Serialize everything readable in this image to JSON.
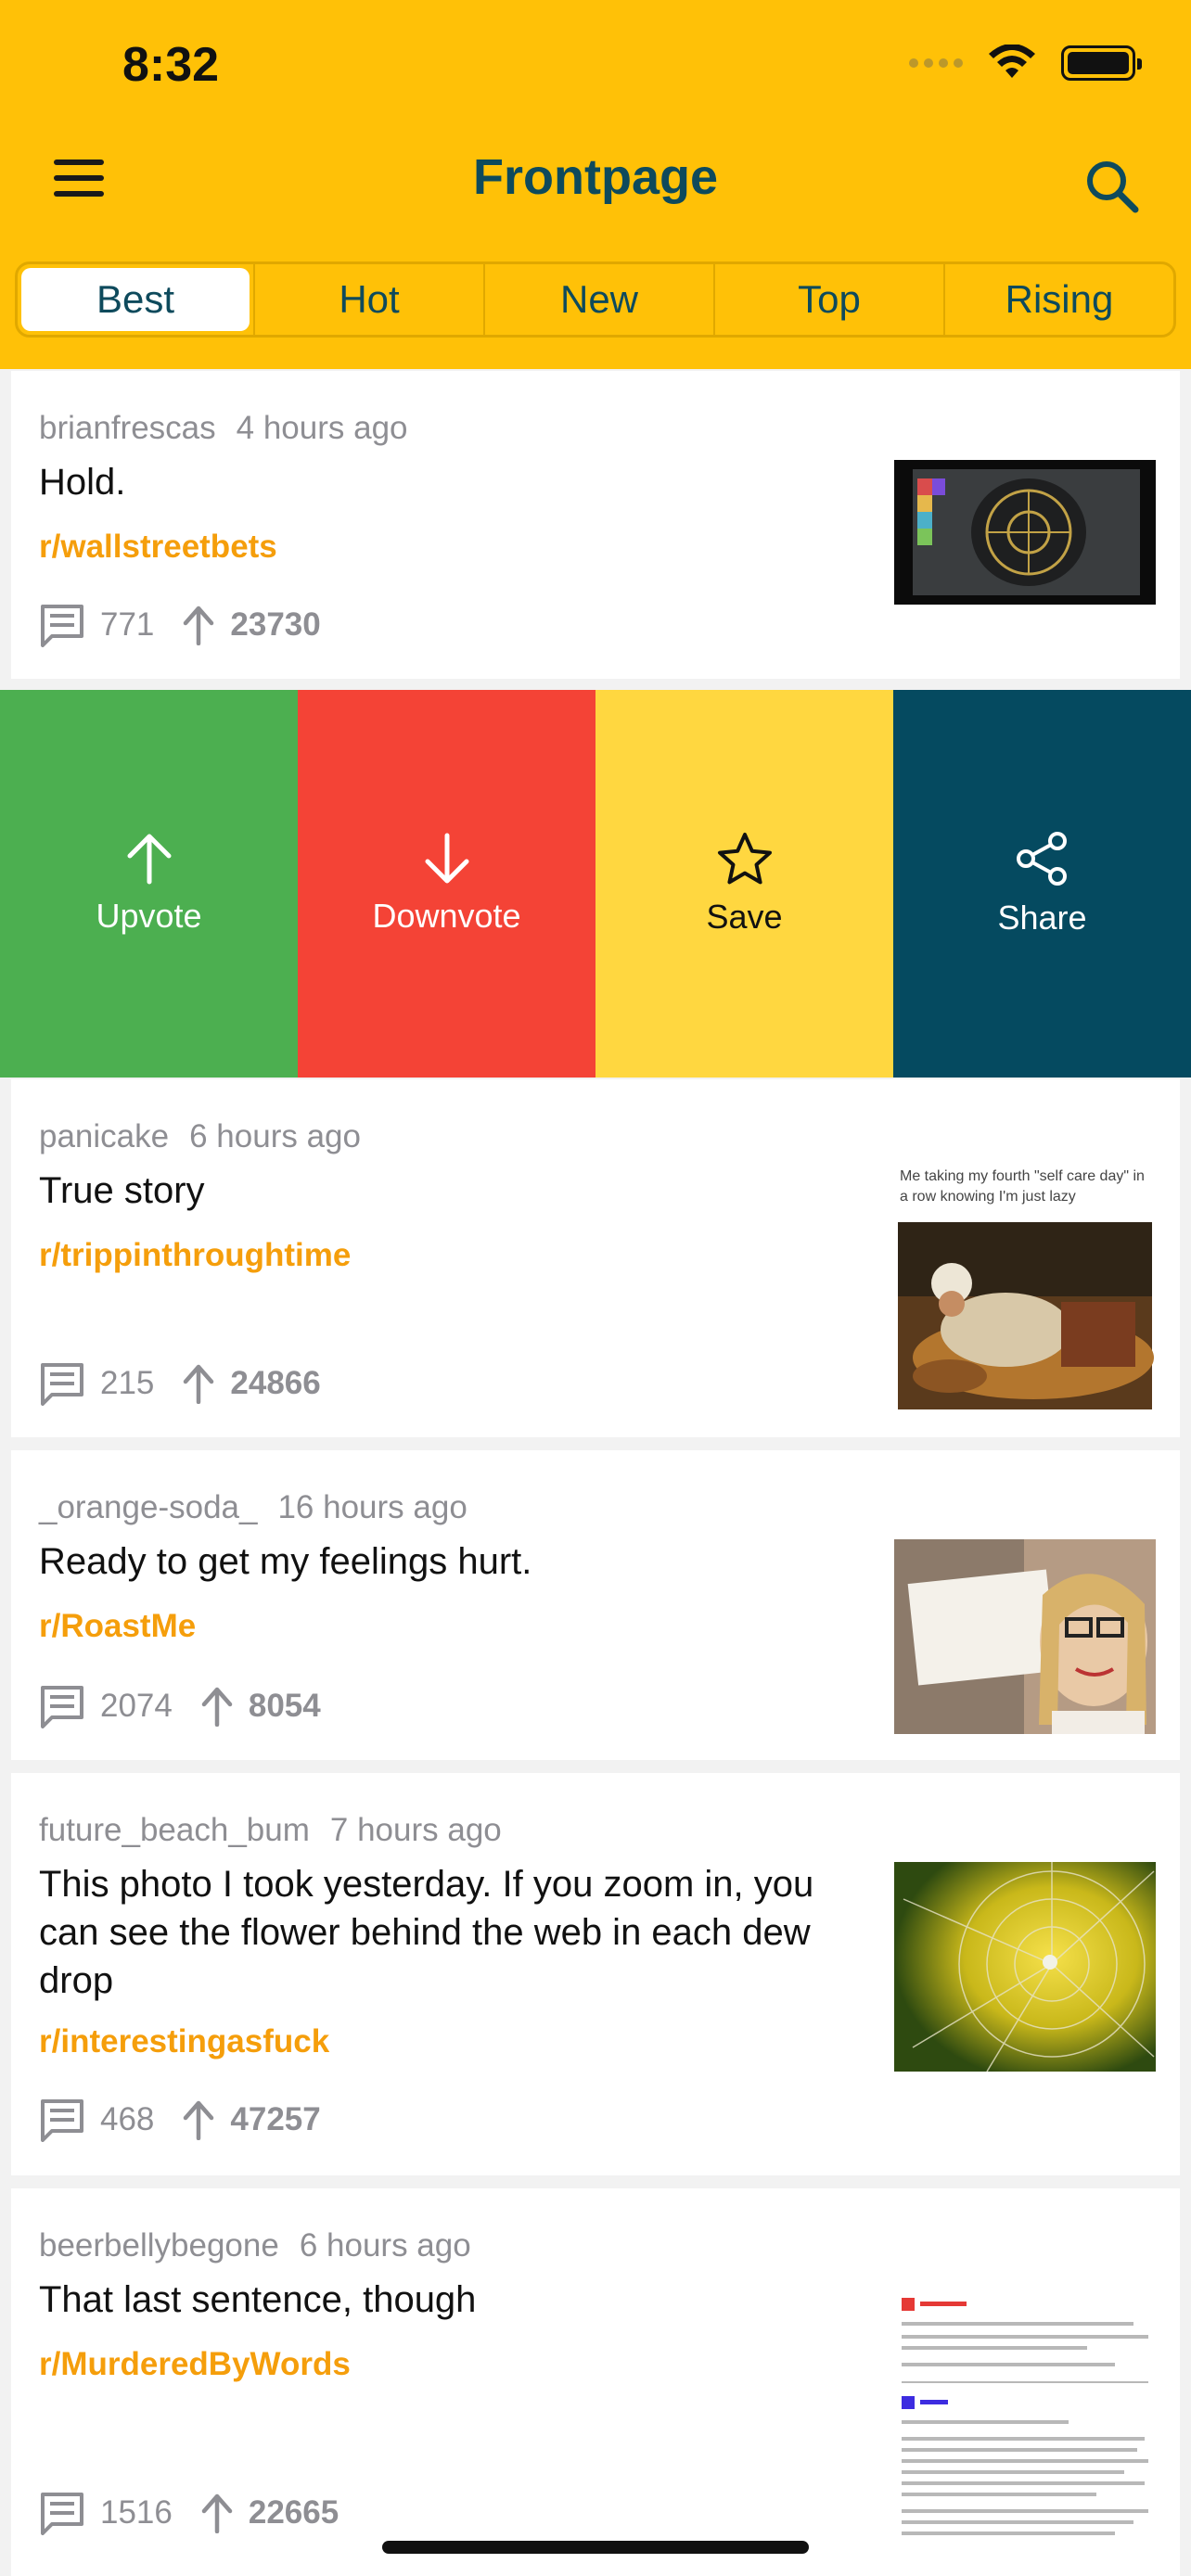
{
  "status": {
    "time": "8:32"
  },
  "header": {
    "title": "Frontpage",
    "menu_icon": "hamburger-menu-icon",
    "search_icon": "search-icon"
  },
  "tabs": [
    {
      "label": "Best",
      "active": true
    },
    {
      "label": "Hot",
      "active": false
    },
    {
      "label": "New",
      "active": false
    },
    {
      "label": "Top",
      "active": false
    },
    {
      "label": "Rising",
      "active": false
    }
  ],
  "posts": [
    {
      "author": "brianfrescas",
      "time": "4 hours ago",
      "title": "Hold.",
      "subreddit": "r/wallstreetbets",
      "comments": "771",
      "score": "23730"
    },
    {
      "author": "panicake",
      "time": "6 hours ago",
      "title": "True story",
      "subreddit": "r/trippinthroughtime",
      "comments": "215",
      "score": "24866",
      "thumb_caption": "Me taking my fourth \"self care day\" in a row knowing I'm just lazy"
    },
    {
      "author": "_orange-soda_",
      "time": "16 hours ago",
      "title": "Ready to get my feelings hurt.",
      "subreddit": "r/RoastMe",
      "comments": "2074",
      "score": "8054"
    },
    {
      "author": "future_beach_bum",
      "time": "7 hours ago",
      "title": "This photo I took yesterday. If you zoom in, you can see the flower behind the web in each dew drop",
      "subreddit": "r/interestingasfuck",
      "comments": "468",
      "score": "47257"
    },
    {
      "author": "beerbellybegone",
      "time": "6 hours ago",
      "title": "That last sentence, though",
      "subreddit": "r/MurderedByWords",
      "comments": "1516",
      "score": "22665"
    }
  ],
  "swipe_actions": [
    {
      "label": "Upvote",
      "icon": "arrow-up-icon",
      "color": "#4CAF50"
    },
    {
      "label": "Downvote",
      "icon": "arrow-down-icon",
      "color": "#F44336"
    },
    {
      "label": "Save",
      "icon": "star-icon",
      "color": "#FFD740"
    },
    {
      "label": "Share",
      "icon": "share-icon",
      "color": "#054A60"
    }
  ],
  "colors": {
    "header": "#FFC107",
    "title": "#0E4A5C",
    "subreddit": "#F59E0B"
  }
}
